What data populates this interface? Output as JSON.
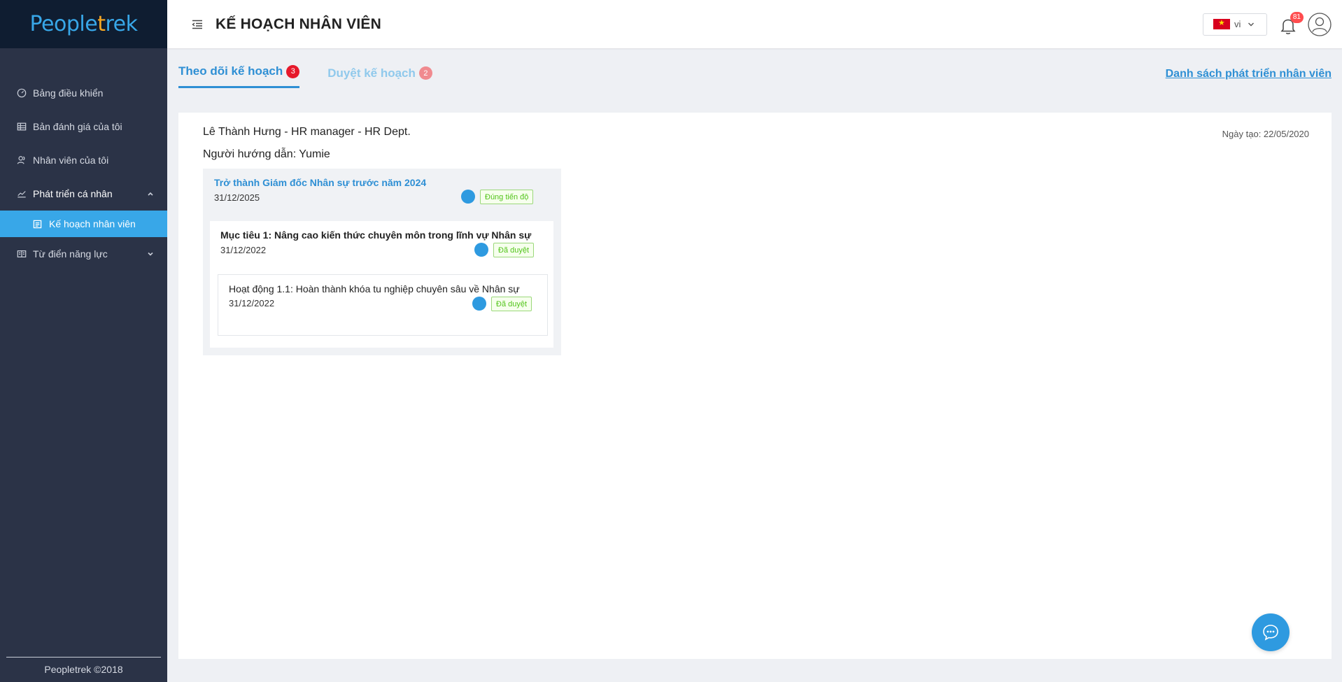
{
  "brand": {
    "logo_text_a": "People",
    "logo_text_b": "rek",
    "logo_cross": "t",
    "footer": "Peopletrek ©2018"
  },
  "sidebar": {
    "items": [
      {
        "label": "Bảng điều khiển",
        "icon": "dashboard-icon"
      },
      {
        "label": "Bản đánh giá của tôi",
        "icon": "table-icon"
      },
      {
        "label": "Nhân viên của tôi",
        "icon": "users-icon"
      },
      {
        "label": "Phát triển cá nhân",
        "icon": "chart-line-icon",
        "expanded": true
      },
      {
        "label": "Từ điển năng lực",
        "icon": "book-icon"
      }
    ],
    "active_sub": {
      "label": "Kế hoạch nhân viên",
      "icon": "document-icon"
    }
  },
  "header": {
    "title": "KẾ HOẠCH NHÂN VIÊN",
    "language": "vi",
    "notification_count": "81"
  },
  "tabs": [
    {
      "label": "Theo dõi kế hoạch",
      "count": "3",
      "active": true
    },
    {
      "label": "Duyệt kế hoạch",
      "count": "2",
      "active": false
    }
  ],
  "dev_list_link": "Danh sách phát triển nhân viên",
  "employee": {
    "name_line": "Lê Thành Hưng - HR manager - HR Dept.",
    "mentor_line": "Người hướng dẫn: Yumie",
    "created_line": "Ngày tạo: 22/05/2020"
  },
  "plan": {
    "title": "Trở thành Giám đốc Nhân sự trước năm 2024",
    "date": "31/12/2025",
    "status": "Đúng tiến độ",
    "goal": {
      "title": "Mục tiêu 1: Nâng cao kiến thức chuyên môn trong lĩnh vự Nhân sự",
      "date": "31/12/2022",
      "status": "Đã duyệt",
      "activity": {
        "title": "Hoạt động 1.1: Hoàn thành khóa tu nghiệp chuyên sâu về Nhân sự",
        "date": "31/12/2022",
        "status": "Đã duyệt"
      }
    }
  },
  "colors": {
    "accent": "#2e8fd4",
    "sidebar_bg": "#2b3347",
    "active_item": "#38a7e8",
    "badge": "#e6192b",
    "tag_green": "#52c41a"
  }
}
